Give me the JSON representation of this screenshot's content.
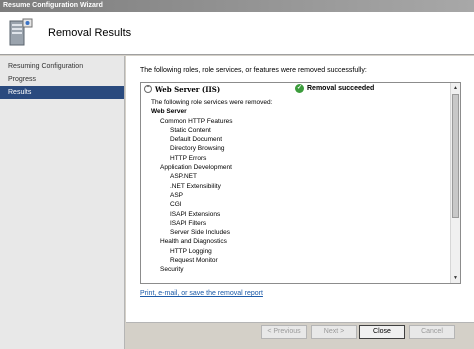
{
  "window": {
    "title": "Resume Configuration Wizard"
  },
  "header": {
    "title": "Removal Results",
    "icon": "server-wizard-icon"
  },
  "sidebar": {
    "items": [
      {
        "label": "Resuming Configuration",
        "active": false
      },
      {
        "label": "Progress",
        "active": false
      },
      {
        "label": "Results",
        "active": true
      }
    ]
  },
  "main": {
    "intro": "The following roles, role services, or features were removed successfully:",
    "role": {
      "name": "Web Server (IIS)",
      "status": "Removal succeeded",
      "status_color": "#3c9c3c",
      "lines": [
        {
          "text": "The following role services were removed:",
          "level": 0
        },
        {
          "text": "Web Server",
          "level": "0b"
        },
        {
          "text": "Common HTTP Features",
          "level": 1
        },
        {
          "text": "Static Content",
          "level": 2
        },
        {
          "text": "Default Document",
          "level": 2
        },
        {
          "text": "Directory Browsing",
          "level": 2
        },
        {
          "text": "HTTP Errors",
          "level": 2
        },
        {
          "text": "Application Development",
          "level": 1
        },
        {
          "text": "ASP.NET",
          "level": 2
        },
        {
          "text": ".NET Extensibility",
          "level": 2
        },
        {
          "text": "ASP",
          "level": 2
        },
        {
          "text": "CGI",
          "level": 2
        },
        {
          "text": "ISAPI Extensions",
          "level": 2
        },
        {
          "text": "ISAPI Filters",
          "level": 2
        },
        {
          "text": "Server Side Includes",
          "level": 2
        },
        {
          "text": "Health and Diagnostics",
          "level": 1
        },
        {
          "text": "HTTP Logging",
          "level": 2
        },
        {
          "text": "Request Monitor",
          "level": 2
        },
        {
          "text": "Security",
          "level": 1
        }
      ]
    },
    "link": "Print, e-mail, or save the removal report"
  },
  "footer": {
    "previous": "< Previous",
    "next": "Next >",
    "close": "Close",
    "cancel": "Cancel"
  },
  "colors": {
    "nav_active": "#2a4a7e",
    "link": "#1b5aa8"
  }
}
